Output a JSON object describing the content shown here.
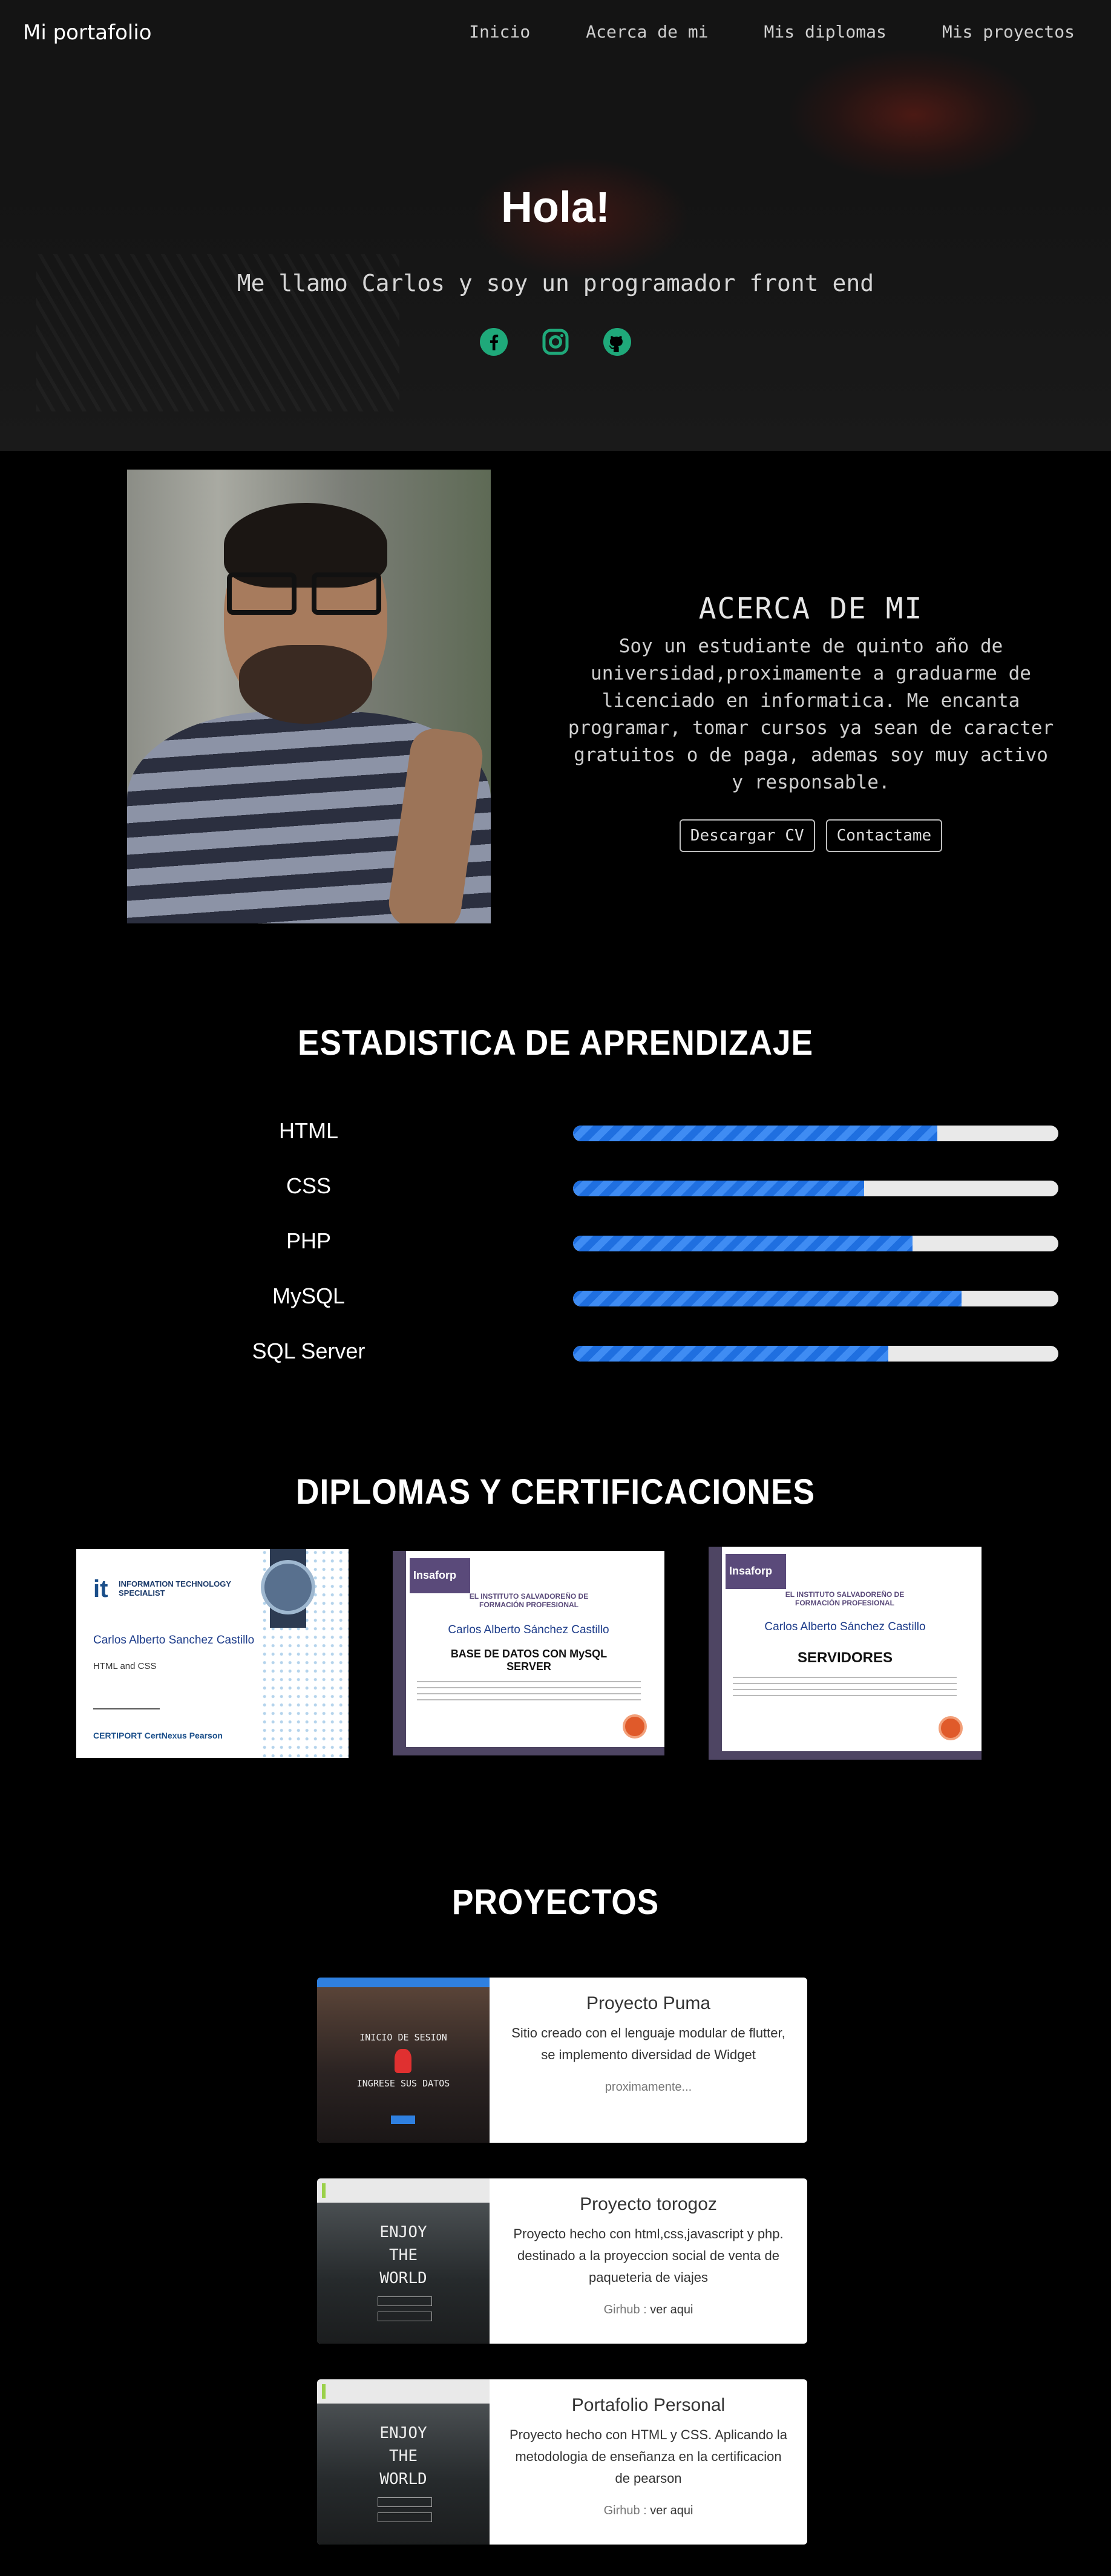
{
  "nav": {
    "brand": "Mi portafolio",
    "links": [
      "Inicio",
      "Acerca de mi",
      "Mis diplomas",
      "Mis proyectos"
    ]
  },
  "hero": {
    "title": "Hola!",
    "subtitle": "Me llamo Carlos y soy un programador front end",
    "socials": [
      "facebook-icon",
      "instagram-icon",
      "github-icon"
    ],
    "social_color": "#1fa97a"
  },
  "about": {
    "title": "ACERCA DE MI",
    "text": "Soy un estudiante de quinto año de universidad,proximamente a graduarme de licenciado en informatica. Me encanta programar, tomar cursos ya sean de caracter gratuitos o de paga, ademas soy muy activo y responsable.",
    "download_cv": "Descargar CV",
    "contact": "Contactame"
  },
  "stats": {
    "title": "ESTADISTICA DE APRENDIZAJE",
    "skills": [
      {
        "label": "HTML",
        "level": 0.75
      },
      {
        "label": "CSS",
        "level": 0.6
      },
      {
        "label": "PHP",
        "level": 0.7
      },
      {
        "label": "MySQL",
        "level": 0.8
      },
      {
        "label": "SQL Server",
        "level": 0.65
      }
    ],
    "bar_color": "#1f6fe0"
  },
  "diplomas": {
    "title": "DIPLOMAS Y CERTIFICACIONES",
    "items": [
      {
        "header": "INFORMATION TECHNOLOGY SPECIALIST",
        "name": "Carlos Alberto Sanchez Castillo",
        "subject": "HTML and CSS",
        "footer": "CERTIPORT    CertNexus    Pearson"
      },
      {
        "org": "Insaforp",
        "header": "EL INSTITUTO SALVADOREÑO DE FORMACIÓN PROFESIONAL",
        "name": "Carlos Alberto Sánchez Castillo",
        "course": "BASE DE DATOS CON MySQL SERVER"
      },
      {
        "org": "Insaforp",
        "header": "EL INSTITUTO SALVADOREÑO DE FORMACIÓN PROFESIONAL",
        "name": "Carlos Alberto Sánchez Castillo",
        "course": "SERVIDORES"
      }
    ]
  },
  "projects": {
    "title": "PROYECTOS",
    "items": [
      {
        "title": "Proyecto Puma",
        "desc": "Sitio creado con el lenguaje modular de flutter, se implemento diversidad de Widget",
        "link_prefix": "",
        "link_text": "proximamente...",
        "thumb_lines": [
          "INICIO DE SESION",
          "INGRESE SUS DATOS"
        ]
      },
      {
        "title": "Proyecto torogoz",
        "desc": "Proyecto hecho con html,css,javascript y php. destinado a la proyeccion social de venta de paqueteria de viajes",
        "link_prefix": "Girhub : ",
        "link_text": "ver aqui",
        "thumb_lines": [
          "ENJOY",
          "THE",
          "WORLD"
        ]
      },
      {
        "title": "Portafolio Personal",
        "desc": "Proyecto hecho con HTML y CSS. Aplicando la metodologia de enseñanza en la certificacion de pearson",
        "link_prefix": "Girhub : ",
        "link_text": "ver aqui",
        "thumb_lines": [
          "ENJOY",
          "THE",
          "WORLD"
        ]
      }
    ]
  }
}
